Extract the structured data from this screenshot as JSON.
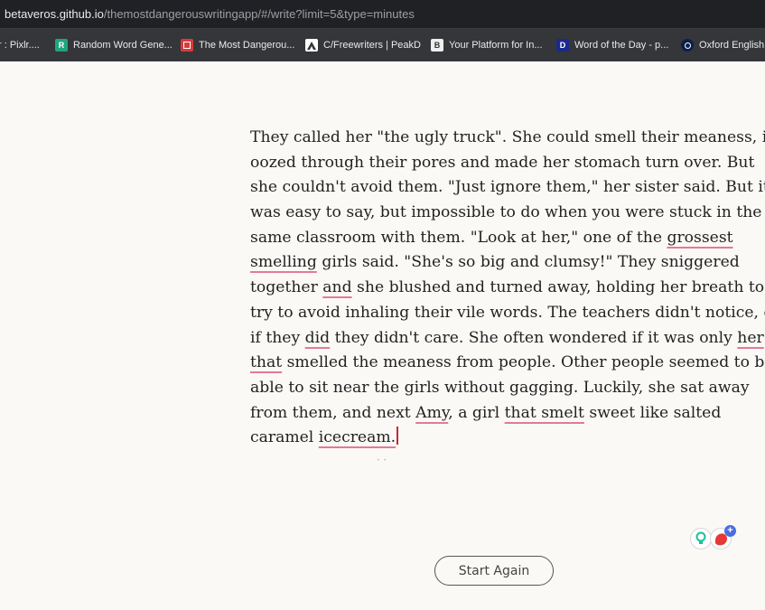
{
  "browser": {
    "url_host": "betaveros.github.io",
    "url_path": "/themostdangerouswritingapp/#/write?limit=5&type=minutes"
  },
  "bookmarks": [
    {
      "label": "r : Pixlr....",
      "icon": "none"
    },
    {
      "label": "Random Word Gene...",
      "icon": "random-word-icon"
    },
    {
      "label": "The Most Dangerou...",
      "icon": "dangerous-app-icon"
    },
    {
      "label": "C/Freewriters | PeakD",
      "icon": "peakd-icon"
    },
    {
      "label": "Your Platform for In...",
      "icon": "platform-icon"
    },
    {
      "label": "Word of the Day - p...",
      "icon": "dictionary-icon"
    },
    {
      "label": "Oxford English",
      "icon": "oxford-icon"
    }
  ],
  "editor": {
    "lines": [
      [
        {
          "t": "They called her \"the ugly truck\". She could smell their meaness, it"
        }
      ],
      [
        {
          "t": "oozed through their pores and made her stomach turn over. But"
        }
      ],
      [
        {
          "t": "she couldn't avoid them. \"Just ignore them,\" her sister said. But it"
        }
      ],
      [
        {
          "t": "was easy to say, but impossible to do when you were stuck in the"
        }
      ],
      [
        {
          "t": "same classroom with them. \"Look at her,\" one of the "
        },
        {
          "t": "grossest",
          "u": true
        }
      ],
      [
        {
          "t": "smelling",
          "u": true
        },
        {
          "t": " girls said. \"She's so big and clumsy!\" They sniggered"
        }
      ],
      [
        {
          "t": "together "
        },
        {
          "t": "and",
          "u": true
        },
        {
          "t": " she blushed and turned away, holding her breath to"
        }
      ],
      [
        {
          "t": "try to avoid inhaling their vile words. The teachers didn't notice, or"
        }
      ],
      [
        {
          "t": "if they "
        },
        {
          "t": "did",
          "u": true
        },
        {
          "t": " they didn't care. She often wondered if it was only "
        },
        {
          "t": "her",
          "u": true
        }
      ],
      [
        {
          "t": "that",
          "u": true
        },
        {
          "t": " smelled the meaness from people. Other people seemed to be"
        }
      ],
      [
        {
          "t": "able to sit near the girls without gagging. Luckily, she sat away"
        }
      ],
      [
        {
          "t": "from them, and next "
        },
        {
          "t": "Amy",
          "u": true
        },
        {
          "t": ", a girl "
        },
        {
          "t": "that smelt",
          "u": true
        },
        {
          "t": " sweet like salted"
        }
      ],
      [
        {
          "t": "caramel "
        },
        {
          "t": "icecream.",
          "u": true
        }
      ]
    ]
  },
  "grammar_widget": {
    "bulb_icon": "lightbulb-icon",
    "badge_icon": "assistant-icon",
    "plus": "+"
  },
  "controls": {
    "start_again_label": "Start Again"
  },
  "colors": {
    "page_background": "#fbf9f6",
    "spellcheck_underline": "#e27a99",
    "caret": "#c4263d"
  }
}
